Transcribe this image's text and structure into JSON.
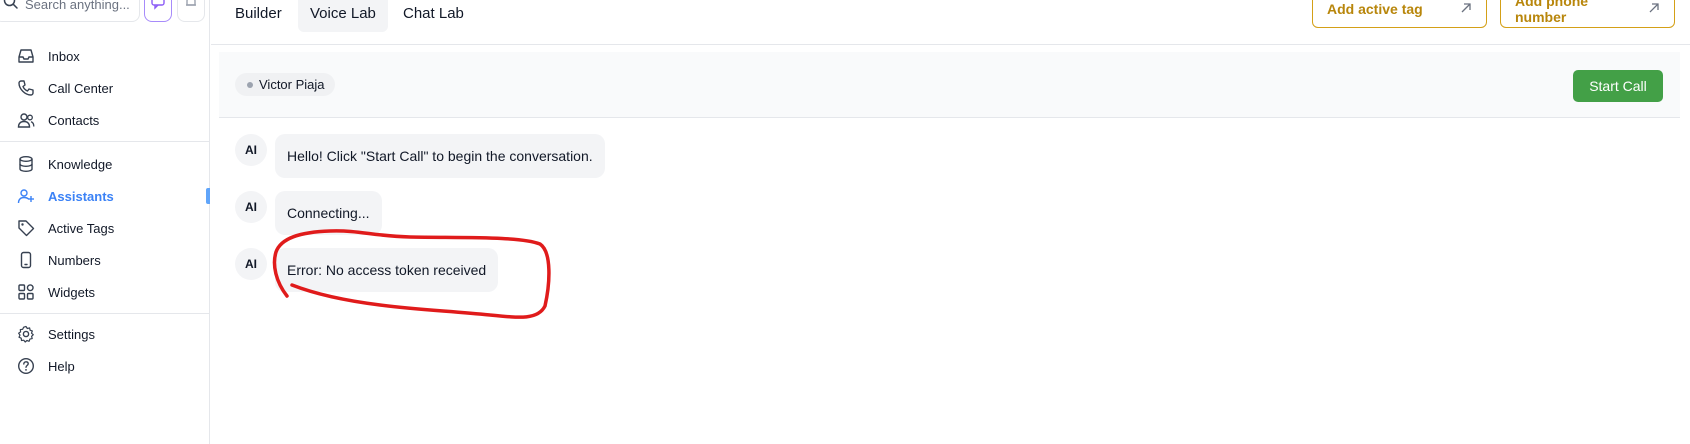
{
  "sidebar": {
    "search_placeholder": "Search anything...",
    "groups": [
      {
        "items": [
          {
            "label": "Inbox",
            "icon": "inbox-icon"
          },
          {
            "label": "Call Center",
            "icon": "phone-icon"
          },
          {
            "label": "Contacts",
            "icon": "users-icon"
          }
        ]
      },
      {
        "items": [
          {
            "label": "Knowledge",
            "icon": "database-icon"
          },
          {
            "label": "Assistants",
            "icon": "user-plus-icon",
            "active": true
          },
          {
            "label": "Active Tags",
            "icon": "tag-icon"
          },
          {
            "label": "Numbers",
            "icon": "smartphone-icon"
          },
          {
            "label": "Widgets",
            "icon": "widgets-icon"
          }
        ]
      },
      {
        "items": [
          {
            "label": "Settings",
            "icon": "gear-icon"
          },
          {
            "label": "Help",
            "icon": "help-icon"
          }
        ]
      }
    ]
  },
  "topbar": {
    "tabs": [
      {
        "label": "Builder"
      },
      {
        "label": "Voice Lab",
        "active": true
      },
      {
        "label": "Chat Lab"
      }
    ],
    "add_active_tag": "Add active tag",
    "add_phone_number": "Add phone number"
  },
  "chat": {
    "contact_name": "Victor Piaja",
    "start_call": "Start Call",
    "messages": [
      {
        "sender": "AI",
        "text": "Hello! Click \"Start Call\" to begin the conversation."
      },
      {
        "sender": "AI",
        "text": "Connecting..."
      },
      {
        "sender": "AI",
        "text": "Error: No access token received"
      }
    ]
  },
  "colors": {
    "accent_blue": "#3b82f6",
    "button_green": "#43a047",
    "outline_gold": "#d4a017",
    "annotation_red": "#e01b1b"
  }
}
